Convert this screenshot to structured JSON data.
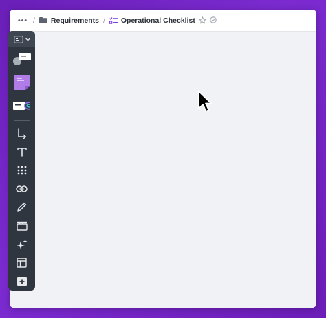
{
  "header": {
    "more_label": "•••",
    "breadcrumb_sep": "/",
    "crumbs": [
      {
        "label": "Requirements",
        "icon": "folder-icon"
      },
      {
        "label": "Operational Checklist",
        "icon": "checklist-icon"
      }
    ]
  },
  "toolbar": {
    "items": [
      "board-view-icon",
      "shape-card-icon",
      "sticky-note-icon",
      "template-card-icon",
      "connector-arrow-icon",
      "text-icon",
      "grid-apps-icon",
      "link-icon",
      "pencil-icon",
      "frame-icon",
      "sparkle-ai-icon",
      "layout-icon",
      "add-icon"
    ]
  },
  "colors": {
    "background": "#6a1fb8",
    "toolbar": "#2f3640",
    "canvas": "#f0f2f5",
    "accent": "#7b3fe4"
  }
}
